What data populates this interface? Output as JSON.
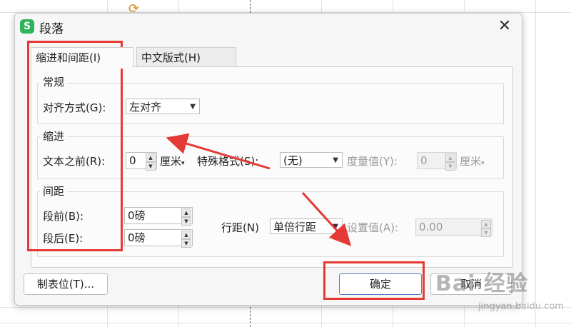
{
  "dialog": {
    "title": "段落",
    "app_icon": "S",
    "close_glyph": "✕"
  },
  "tabs": [
    {
      "label": "缩进和间距(I)",
      "active": true
    },
    {
      "label": "中文版式(H)",
      "active": false
    }
  ],
  "general": {
    "group_label": "常规",
    "align_label": "对齐方式(G):",
    "align_value": "左对齐"
  },
  "indent": {
    "group_label": "缩进",
    "before_label": "文本之前(R):",
    "before_value": "0",
    "before_unit": "厘米",
    "special_label": "特殊格式(S):",
    "special_value": "(无)",
    "measure_label": "度量值(Y):",
    "measure_value": "0",
    "measure_unit": "厘米"
  },
  "spacing": {
    "group_label": "间距",
    "before_label": "段前(B):",
    "before_value": "0磅",
    "after_label": "段后(E):",
    "after_value": "0磅",
    "line_label": "行距(N)",
    "line_value": "单倍行距",
    "set_label": "设置值(A):",
    "set_value": "0.00"
  },
  "buttons": {
    "tabs_label": "制表位(T)...",
    "ok_label": "确定",
    "cancel_label": "取消"
  },
  "watermark": {
    "main": "Bai 经验",
    "sub": "jingyan.baidu.com"
  },
  "colors": {
    "annotation_red": "#e53935",
    "app_green": "#2db45b",
    "primary_border": "#4a7cc7"
  }
}
